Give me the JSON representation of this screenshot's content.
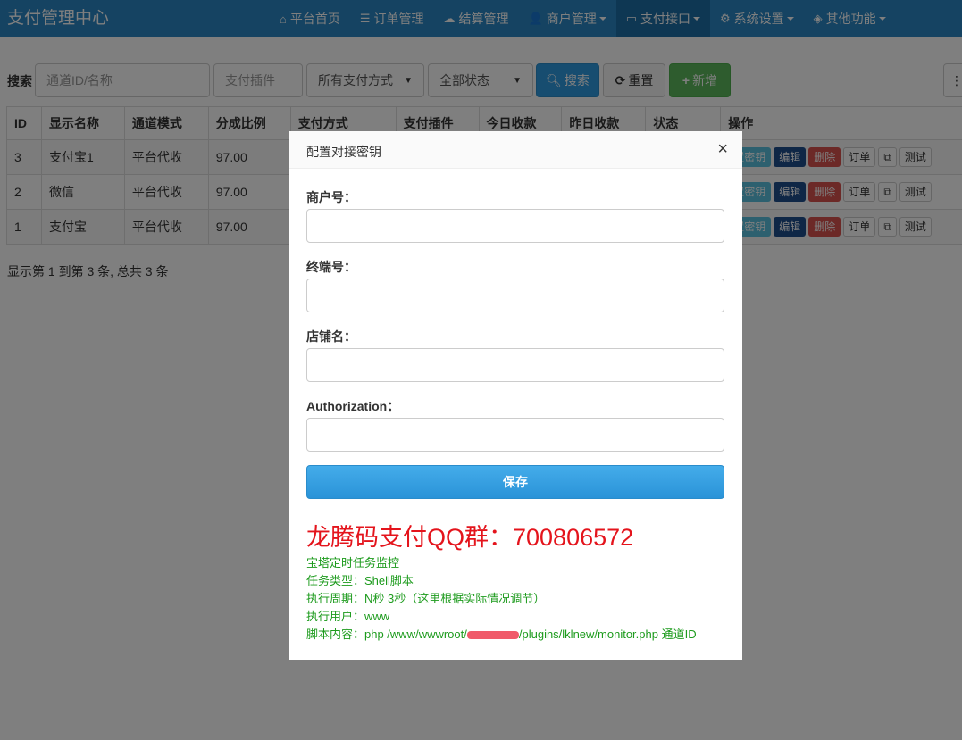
{
  "brand": "支付管理中心",
  "nav": [
    {
      "icon": "⌂",
      "icon_name": "home-icon",
      "label": "平台首页",
      "dropdown": false,
      "active": false
    },
    {
      "icon": "☰",
      "icon_name": "list-icon",
      "label": "订单管理",
      "dropdown": false,
      "active": false
    },
    {
      "icon": "☁",
      "icon_name": "cloud-icon",
      "label": "结算管理",
      "dropdown": false,
      "active": false
    },
    {
      "icon": "👤",
      "icon_name": "user-icon",
      "label": "商户管理",
      "dropdown": true,
      "active": false
    },
    {
      "icon": "▭",
      "icon_name": "credit-card-icon",
      "label": "支付接口",
      "dropdown": true,
      "active": true
    },
    {
      "icon": "⚙",
      "icon_name": "gear-icon",
      "label": "系统设置",
      "dropdown": true,
      "active": false
    },
    {
      "icon": "◈",
      "icon_name": "cube-icon",
      "label": "其他功能",
      "dropdown": true,
      "active": false
    }
  ],
  "search": {
    "label": "搜索",
    "channel_placeholder": "通道ID/名称",
    "plugin_placeholder": "支付插件",
    "method_value": "所有支付方式",
    "status_value": "全部状态",
    "search_button": "搜索",
    "reset_button": "重置",
    "add_button": "新增"
  },
  "table": {
    "headers": [
      "ID",
      "显示名称",
      "通道模式",
      "分成比例",
      "支付方式",
      "支付插件",
      "今日收款",
      "昨日收款",
      "状态",
      "操作"
    ],
    "rows": [
      {
        "id": "3",
        "name": "支付宝1",
        "mode": "平台代收",
        "ratio": "97.00"
      },
      {
        "id": "2",
        "name": "微信",
        "mode": "平台代收",
        "ratio": "97.00"
      },
      {
        "id": "1",
        "name": "支付宝",
        "mode": "平台代收",
        "ratio": "97.00"
      }
    ],
    "ops": {
      "key": "置密钥",
      "edit": "编辑",
      "delete": "删除",
      "order": "订单",
      "test": "测试"
    }
  },
  "footer": "显示第 1 到第 3 条, 总共 3 条",
  "modal": {
    "title": "配置对接密钥",
    "close": "×",
    "labels": [
      "商户号：",
      "终端号：",
      "店铺名：",
      "Authorization："
    ],
    "save": "保存",
    "qq": "龙腾码支付QQ群：700806572",
    "notes": [
      "宝塔定时任务监控",
      "任务类型：Shell脚本",
      "执行周期：N秒 3秒（这里根据实际情况调节）",
      "执行用户：www"
    ],
    "script_prefix": "脚本内容：php /www/wwwroot/",
    "script_suffix": "/plugins/lklnew/monitor.php 通道ID"
  },
  "colors": {
    "nav_bg": "#2a87c4",
    "nav_active": "#1d6ea6",
    "qq_red": "#e4141c",
    "note_green": "#1d9b1d"
  }
}
